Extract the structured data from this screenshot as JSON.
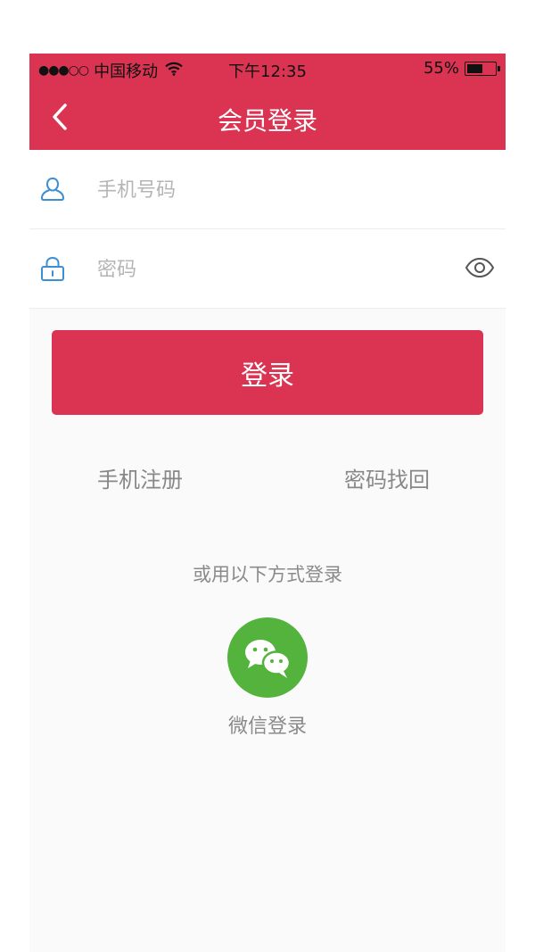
{
  "status_bar": {
    "signal": "●●●○○",
    "carrier": "中国移动",
    "time": "下午12:35",
    "battery_text": "55%",
    "battery_level": 0.55
  },
  "nav": {
    "title": "会员登录"
  },
  "form": {
    "phone_placeholder": "手机号码",
    "password_placeholder": "密码"
  },
  "login_label": "登录",
  "links": {
    "register": "手机注册",
    "recover": "密码找回"
  },
  "alt_login": {
    "title": "或用以下方式登录",
    "wechat_label": "微信登录"
  },
  "colors": {
    "brand": "#da3452",
    "wechat": "#53b33c",
    "icon_blue": "#3d8fd3"
  }
}
